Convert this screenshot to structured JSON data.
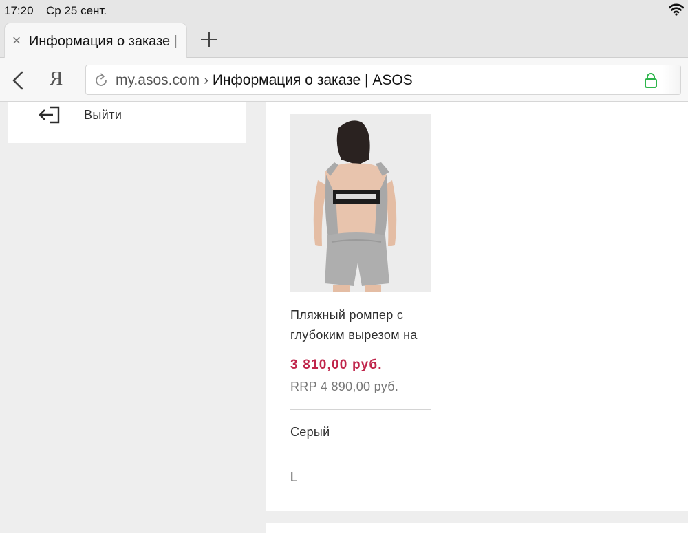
{
  "status_bar": {
    "time": "17:20",
    "date": "Ср 25 сент."
  },
  "tab": {
    "title": "Информация о заказе | ASOS",
    "close_glyph": "×"
  },
  "address_bar": {
    "domain": "my.asos.com",
    "separator": " › ",
    "page_title": "Информация о заказе | ASOS",
    "browser_logo": "Я"
  },
  "sidebar": {
    "logout_label": "Выйти"
  },
  "product": {
    "name": "Пляжный ромпер с глубоким вырезом на",
    "price_current": "3 810,00 руб.",
    "price_rrp": "RRP 4 890,00 руб.",
    "color": "Серый",
    "size": "L"
  },
  "colors": {
    "price_accent": "#c0254b",
    "secure_lock": "#2db54b"
  },
  "icons": [
    "wifi-icon",
    "close-icon",
    "plus-icon",
    "back-icon",
    "reload-icon",
    "lock-icon",
    "logout-icon"
  ]
}
